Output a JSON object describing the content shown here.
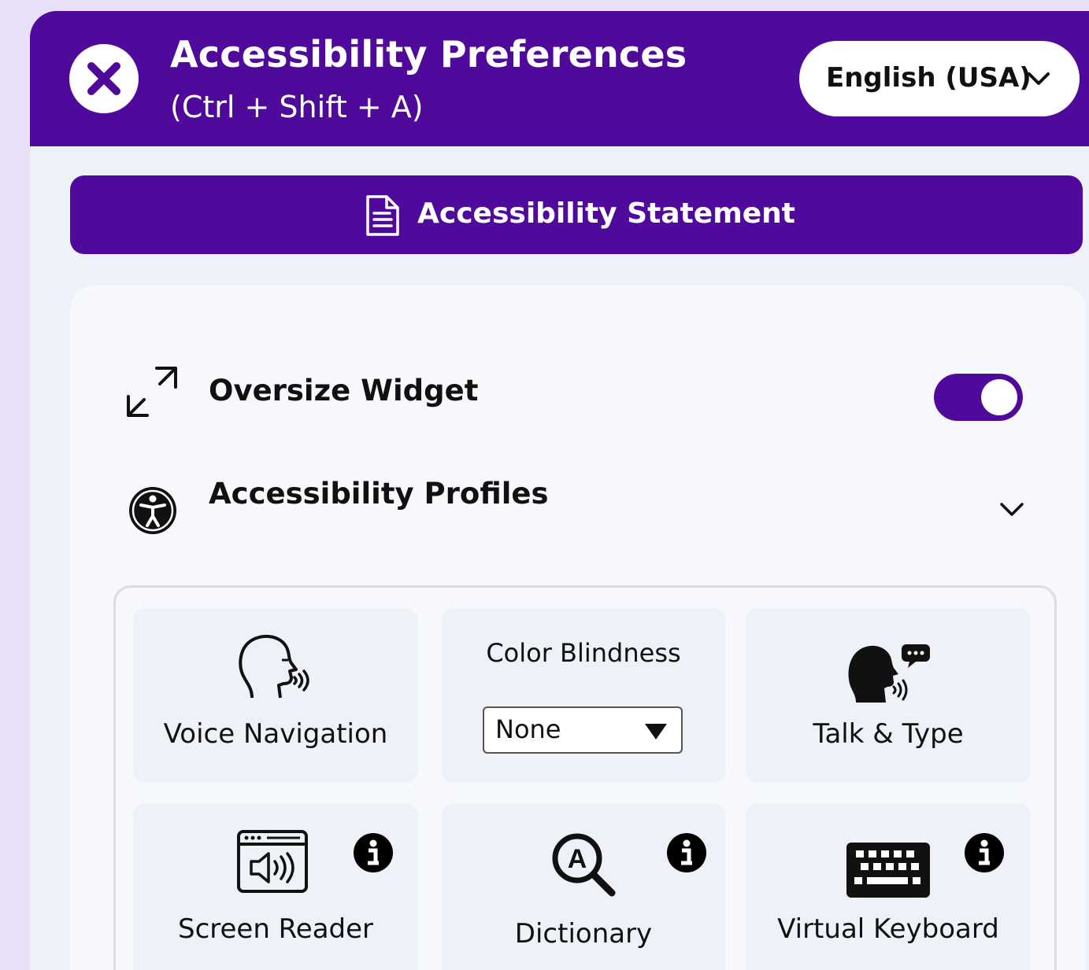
{
  "header": {
    "title": "Accessibility Preferences",
    "shortcut": "(Ctrl + Shift + A)",
    "language": "English (USA)",
    "close_icon": "close-icon"
  },
  "statement_button": {
    "label": "Accessibility Statement",
    "icon": "document-icon"
  },
  "settings": {
    "oversize_widget": {
      "label": "Oversize Widget",
      "icon": "expand-arrows-icon",
      "enabled": true
    },
    "profiles": {
      "label": "Accessibility Profiles",
      "icon": "accessibility-person-icon",
      "expanded": false
    }
  },
  "tools": {
    "voice_navigation": {
      "label": "Voice Navigation",
      "icon": "speaking-head-icon"
    },
    "color_blindness": {
      "label": "Color Blindness",
      "selected": "None"
    },
    "talk_type": {
      "label": "Talk & Type",
      "icon": "talk-type-icon"
    },
    "screen_reader": {
      "label": "Screen Reader",
      "icon": "screen-reader-icon"
    },
    "dictionary": {
      "label": "Dictionary",
      "icon": "dictionary-search-icon"
    },
    "virtual_keyboard": {
      "label": "Virtual Keyboard",
      "icon": "keyboard-icon"
    }
  },
  "colors": {
    "brand_purple": "#4f0a9c",
    "panel_bg": "#eef1f7",
    "tile_bg": "#eef1f7"
  }
}
